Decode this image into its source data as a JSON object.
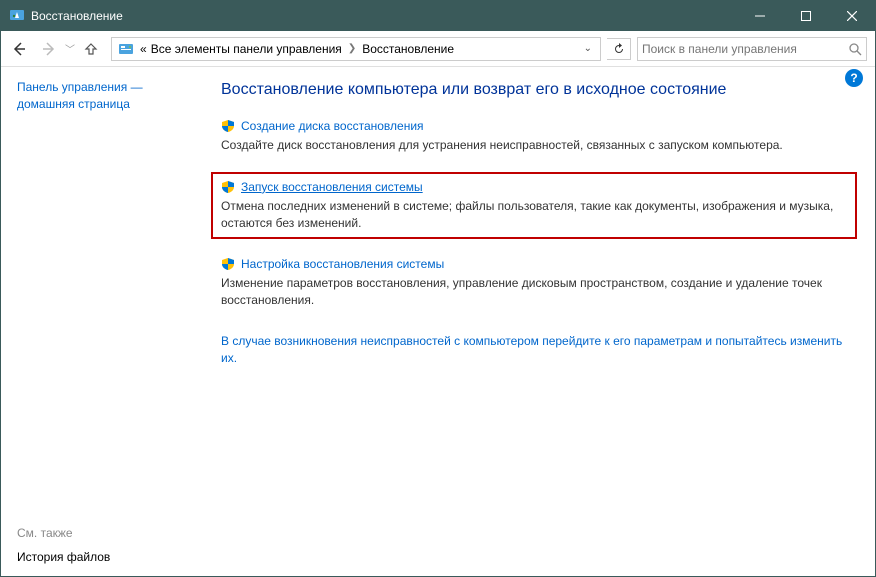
{
  "titlebar": {
    "title": "Восстановление"
  },
  "addressbar": {
    "crumb1": "Все элементы панели управления",
    "crumb2": "Восстановление",
    "prefix": "«"
  },
  "search": {
    "placeholder": "Поиск в панели управления"
  },
  "sidebar": {
    "main_link_l1": "Панель управления —",
    "main_link_l2": "домашняя страница",
    "see_also": "См. также",
    "history": "История файлов"
  },
  "main": {
    "heading": "Восстановление компьютера или возврат его в исходное состояние",
    "blocks": [
      {
        "link": "Создание диска восстановления",
        "desc": "Создайте диск восстановления для устранения неисправностей, связанных с запуском компьютера."
      },
      {
        "link": "Запуск восстановления системы",
        "desc": "Отмена последних изменений в системе; файлы пользователя, такие как документы, изображения и музыка, остаются без изменений."
      },
      {
        "link": "Настройка восстановления системы",
        "desc": "Изменение параметров восстановления, управление дисковым пространством, создание и удаление точек восстановления."
      }
    ],
    "footer": "В случае возникновения неисправностей с компьютером перейдите к его параметрам и попытайтесь изменить их."
  }
}
